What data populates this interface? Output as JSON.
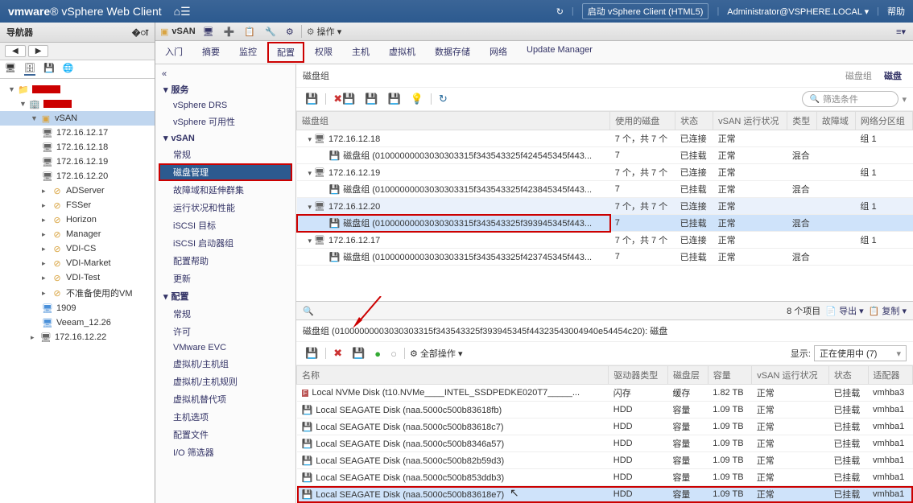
{
  "titlebar": {
    "product": "vSphere Web Client",
    "vm": "vm",
    "ware": "ware",
    "launch_html5": "启动 vSphere Client (HTML5)",
    "user": "Administrator@VSPHERE.LOCAL",
    "help": "帮助"
  },
  "nav": {
    "header": "导航器",
    "items": {
      "vsan": "vSAN",
      "hosts": [
        "172.16.12.17",
        "172.16.12.18",
        "172.16.12.19",
        "172.16.12.20"
      ],
      "adserver": "ADServer",
      "fsser": "FSSer",
      "horizon": "Horizon",
      "manager": "Manager",
      "vdics": "VDI-CS",
      "vdimarket": "VDI-Market",
      "vditest": "VDI-Test",
      "unprepared": "不准备使用的VM",
      "vm1909": "1909",
      "veeam": "Veeam_12.26",
      "lasthost": "172.16.12.22"
    }
  },
  "objbar": {
    "name": "vSAN",
    "actions": "操作"
  },
  "tabs": [
    "入门",
    "摘要",
    "监控",
    "配置",
    "权限",
    "主机",
    "虚拟机",
    "数据存储",
    "网络",
    "Update Manager"
  ],
  "active_tab": "配置",
  "secondary": {
    "collapse": "«",
    "groups": {
      "services": "服务",
      "svc_items": [
        "vSphere DRS",
        "vSphere 可用性"
      ],
      "vsan": "vSAN",
      "vsan_items": [
        "常规",
        "磁盘管理",
        "故障域和延伸群集",
        "运行状况和性能",
        "iSCSI 目标",
        "iSCSI 启动器组",
        "配置帮助",
        "更新"
      ],
      "config": "配置",
      "cfg_items": [
        "常规",
        "许可",
        "VMware EVC",
        "虚拟机/主机组",
        "虚拟机/主机规则",
        "虚拟机替代项",
        "主机选项",
        "配置文件",
        "I/O 筛选器"
      ]
    }
  },
  "maintitle": "磁盘组",
  "maintabs": {
    "t1": "磁盘组",
    "t2": "磁盘"
  },
  "filter_placeholder": "筛选条件",
  "grid": {
    "cols": [
      "磁盘组",
      "使用的磁盘",
      "状态",
      "vSAN 运行状况",
      "类型",
      "故障域",
      "网络分区组"
    ],
    "rows": [
      {
        "type": "host",
        "name": "172.16.12.18",
        "disks": "7 个，共 7 个",
        "state": "已连接",
        "health": "正常",
        "dtype": "",
        "fd": "",
        "np": "组 1"
      },
      {
        "type": "dg",
        "name": "磁盘组 (01000000003030303315f343543325f424545345f443...",
        "indent": true,
        "disks": "7",
        "state": "已挂载",
        "health": "正常",
        "dtype": "混合"
      },
      {
        "type": "host",
        "name": "172.16.12.19",
        "disks": "7 个，共 7 个",
        "state": "已连接",
        "health": "正常",
        "np": "组 1"
      },
      {
        "type": "dg",
        "name": "磁盘组 (01000000003030303315f343543325f423845345f443...",
        "indent": true,
        "disks": "7",
        "state": "已挂载",
        "health": "正常",
        "dtype": "混合"
      },
      {
        "type": "host",
        "name": "172.16.12.20",
        "disks": "7 个，共 7 个",
        "state": "已连接",
        "health": "正常",
        "np": "组 1",
        "selected": true
      },
      {
        "type": "dg",
        "name": "磁盘组 (01000000003030303315f343543325f393945345f443...",
        "indent": true,
        "disks": "7",
        "state": "已挂载",
        "health": "正常",
        "dtype": "混合",
        "selected": true,
        "hl": true
      },
      {
        "type": "host",
        "name": "172.16.12.17",
        "disks": "7 个，共 7 个",
        "state": "已连接",
        "health": "正常",
        "np": "组 1"
      },
      {
        "type": "dg",
        "name": "磁盘组 (01000000003030303315f343543325f423745345f443...",
        "indent": true,
        "disks": "7",
        "state": "已挂载",
        "health": "正常",
        "dtype": "混合"
      }
    ],
    "footer_count": "8 个项目",
    "export": "导出",
    "copy": "复制"
  },
  "detail": {
    "title": "磁盘组 (01000000003030303315f343543325f393945345f44323543004940e54454c20): 磁盘",
    "all_actions": "全部操作",
    "show_label": "显示:",
    "show_value": "正在使用中 (7)",
    "cols": [
      "名称",
      "驱动器类型",
      "磁盘层",
      "容量",
      "vSAN 运行状况",
      "状态",
      "适配器"
    ],
    "rows": [
      {
        "name": "Local NVMe Disk (t10.NVMe____INTEL_SSDPEDKE020T7_____...",
        "icon": "F",
        "drive": "闪存",
        "tier": "缓存",
        "cap": "1.82 TB",
        "health": "正常",
        "state": "已挂载",
        "adapter": "vmhba3"
      },
      {
        "name": "Local SEAGATE Disk (naa.5000c500b83618fb)",
        "drive": "HDD",
        "tier": "容量",
        "cap": "1.09 TB",
        "health": "正常",
        "state": "已挂载",
        "adapter": "vmhba1"
      },
      {
        "name": "Local SEAGATE Disk (naa.5000c500b83618c7)",
        "drive": "HDD",
        "tier": "容量",
        "cap": "1.09 TB",
        "health": "正常",
        "state": "已挂载",
        "adapter": "vmhba1"
      },
      {
        "name": "Local SEAGATE Disk (naa.5000c500b8346a57)",
        "drive": "HDD",
        "tier": "容量",
        "cap": "1.09 TB",
        "health": "正常",
        "state": "已挂载",
        "adapter": "vmhba1"
      },
      {
        "name": "Local SEAGATE Disk (naa.5000c500b82b59d3)",
        "drive": "HDD",
        "tier": "容量",
        "cap": "1.09 TB",
        "health": "正常",
        "state": "已挂载",
        "adapter": "vmhba1"
      },
      {
        "name": "Local SEAGATE Disk (naa.5000c500b853ddb3)",
        "drive": "HDD",
        "tier": "容量",
        "cap": "1.09 TB",
        "health": "正常",
        "state": "已挂载",
        "adapter": "vmhba1"
      },
      {
        "name": "Local SEAGATE Disk (naa.5000c500b83618e7)",
        "drive": "HDD",
        "tier": "容量",
        "cap": "1.09 TB",
        "health": "正常",
        "state": "已挂载",
        "adapter": "vmhba1",
        "selected": true,
        "hl": true
      }
    ]
  }
}
